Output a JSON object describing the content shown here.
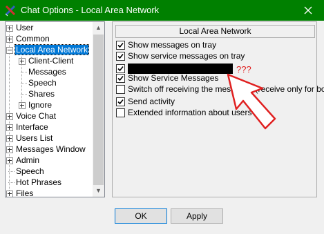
{
  "window": {
    "title": "Chat Options - Local Area Network"
  },
  "tree": {
    "items": [
      {
        "label": "User",
        "expander": "plus"
      },
      {
        "label": "Common",
        "expander": "plus"
      },
      {
        "label": "Local Area Network",
        "expander": "minus",
        "selected": true
      },
      {
        "label": "Client-Client",
        "expander": "plus"
      },
      {
        "label": "Messages",
        "expander": "none"
      },
      {
        "label": "Speech",
        "expander": "none"
      },
      {
        "label": "Shares",
        "expander": "none"
      },
      {
        "label": "Ignore",
        "expander": "plus"
      },
      {
        "label": "Voice Chat",
        "expander": "plus"
      },
      {
        "label": "Interface",
        "expander": "plus"
      },
      {
        "label": "Users List",
        "expander": "plus"
      },
      {
        "label": "Messages Window",
        "expander": "plus"
      },
      {
        "label": "Admin",
        "expander": "plus"
      },
      {
        "label": "Speech",
        "expander": "none"
      },
      {
        "label": "Hot Phrases",
        "expander": "none"
      },
      {
        "label": "Files",
        "expander": "plus"
      }
    ]
  },
  "panel": {
    "header": "Local Area Network",
    "options": [
      {
        "label": "Show messages on tray",
        "checked": true
      },
      {
        "label": "Show service messages on tray",
        "checked": true
      },
      {
        "label": "",
        "checked": true,
        "redacted": true
      },
      {
        "label": "Show Service Messages",
        "checked": true
      },
      {
        "label": "Switch off receiving the messages (receive only for bot)",
        "checked": false
      },
      {
        "label": "Send activity",
        "checked": true
      },
      {
        "label": "Extended information about users",
        "checked": false
      }
    ]
  },
  "annotation": {
    "text": "???",
    "color": "#e02020"
  },
  "buttons": {
    "ok": "OK",
    "apply": "Apply"
  },
  "colors": {
    "titlebar": "#008000",
    "selection": "#0078d7"
  }
}
